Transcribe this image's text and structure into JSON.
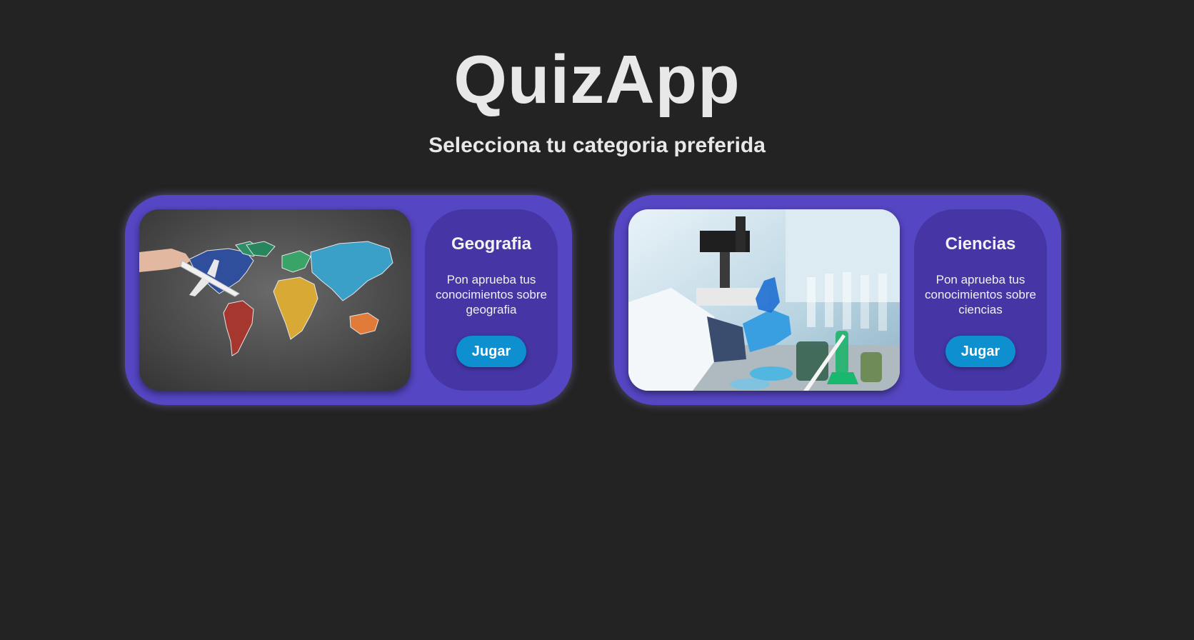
{
  "app": {
    "title": "QuizApp",
    "subtitle": "Selecciona tu categoria preferida"
  },
  "colors": {
    "background": "#232323",
    "card": "#5546c3",
    "panel": "#4535a5",
    "button": "#0d8fd0"
  },
  "categories": [
    {
      "title": "Geografia",
      "description": "Pon aprueba tus conocimientos sobre geografia",
      "button_label": "Jugar",
      "image": "world-map-chalkboard-image"
    },
    {
      "title": "Ciencias",
      "description": "Pon aprueba tus conocimientos sobre ciencias",
      "button_label": "Jugar",
      "image": "science-lab-image"
    }
  ]
}
